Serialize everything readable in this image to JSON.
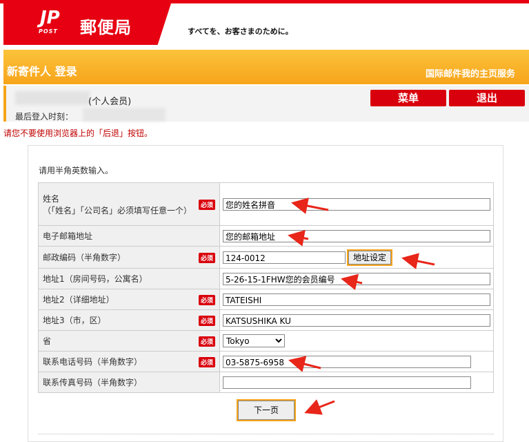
{
  "header": {
    "logo_mark": "JP",
    "logo_post": "POST",
    "brand": "郵便局",
    "tagline": "すべてを、お客さまのために。"
  },
  "title_bar": {
    "title": "新寄件人 登录",
    "home_link": "国际邮件我的主页服务"
  },
  "user": {
    "member_type": "(个人会员)",
    "last_login_label": "最后登入时刻："
  },
  "buttons": {
    "menu": "菜单",
    "logout": "退出",
    "address_setting": "地址设定",
    "next": "下一页"
  },
  "warning": "请您不要使用浏览器上的「后退」按钮。",
  "form": {
    "hint": "请用半角英数输入。",
    "required_badge": "必须",
    "rows": [
      {
        "label": "姓名",
        "sublabel": "（「姓名」「公司名」必须填写任意一个）",
        "value": "您的姓名拼音",
        "required": true
      },
      {
        "label": "电子邮箱地址",
        "value": "您的邮箱地址",
        "required": false
      },
      {
        "label": "邮政编码（半角数字）",
        "value": "124-0012",
        "required": true
      },
      {
        "label": "地址1（房间号码，公寓名）",
        "value": "5-26-15-1FHW您的会员编号",
        "required": false
      },
      {
        "label": "地址2（详细地址）",
        "value": "TATEISHI",
        "required": true
      },
      {
        "label": "地址3（市，区）",
        "value": "KATSUSHIKA KU",
        "required": true
      },
      {
        "label": "省",
        "value": "Tokyo",
        "required": true
      },
      {
        "label": "联系电话号码（半角数字）",
        "value": "03-5875-6958",
        "required": true
      },
      {
        "label": "联系传真号码（半角数字）",
        "value": "",
        "required": false
      }
    ]
  },
  "colors": {
    "brand_red": "#e60012",
    "orange": "#f7a41a",
    "annotation_arrow": "#e8261a"
  }
}
